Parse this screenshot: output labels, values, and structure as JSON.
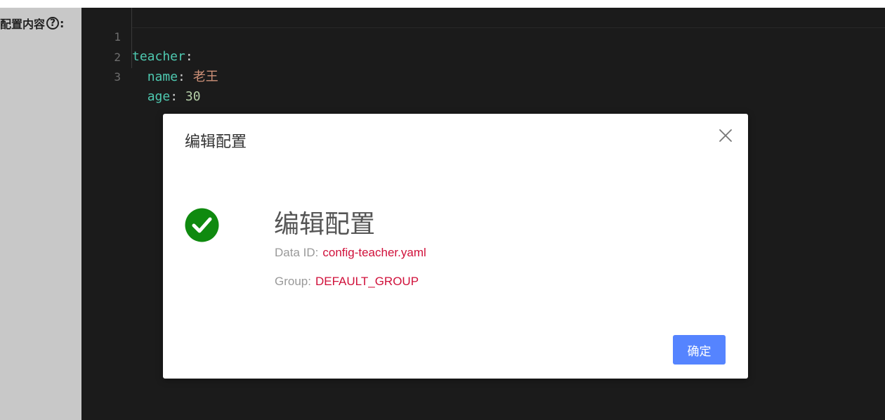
{
  "form": {
    "config_content_label": "配置内容",
    "help_char": "?",
    "colon": ":"
  },
  "editor": {
    "lines": [
      {
        "no": "1",
        "key": "teacher",
        "sep": ":",
        "value": ""
      },
      {
        "no": "2",
        "indent": "  ",
        "key": "name",
        "sep": ": ",
        "value": "老王",
        "value_type": "string"
      },
      {
        "no": "3",
        "indent": "  ",
        "key": "age",
        "sep": ": ",
        "value": "30",
        "value_type": "number"
      }
    ]
  },
  "dialog": {
    "title": "编辑配置",
    "close_icon": "close-icon",
    "status_icon": "check-circle-icon",
    "result_title": "编辑配置",
    "data_id_label": "Data ID:",
    "data_id_value": "config-teacher.yaml",
    "group_label": "Group:",
    "group_value": "DEFAULT_GROUP",
    "confirm_label": "确定"
  },
  "colors": {
    "success": "#0f8a0f",
    "primary": "#5584ff",
    "value_highlight": "#d0103a",
    "editor_bg": "#1b1b1b"
  }
}
